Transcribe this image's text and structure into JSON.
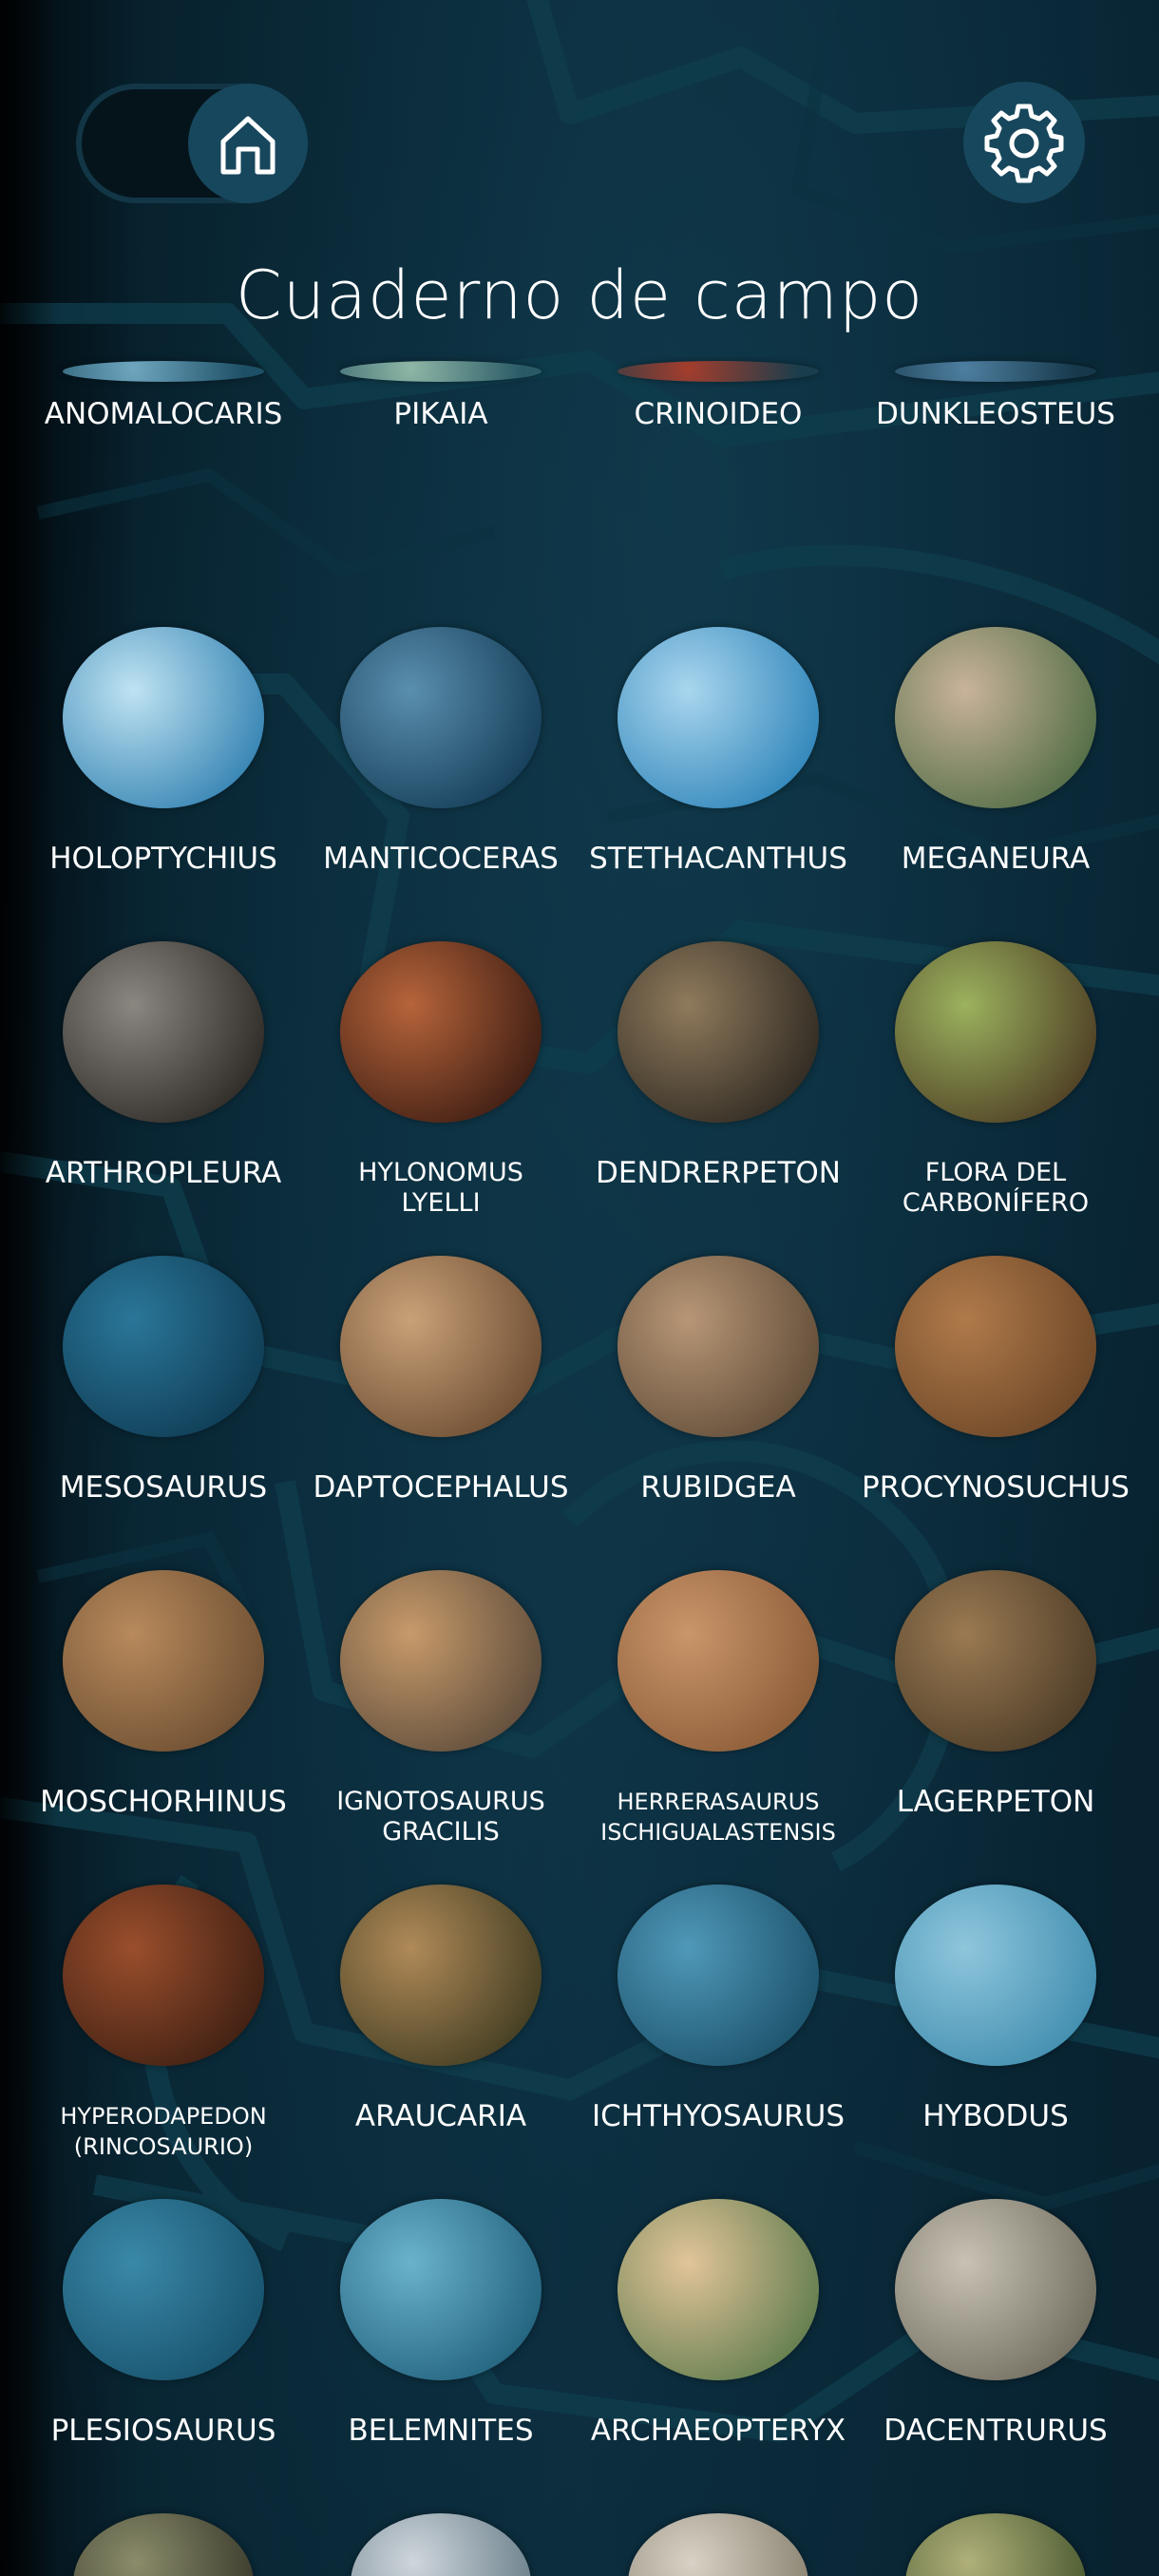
{
  "header": {
    "title": "Cuaderno de campo",
    "home_icon": "home-icon",
    "settings_icon": "gear-icon"
  },
  "colors": {
    "background": "#0a2837",
    "button": "#17475c",
    "text": "#ffffff"
  },
  "entries": [
    {
      "label": "ANOMALOCARIS",
      "palette": [
        "#6fa7bf",
        "#1d4f66"
      ]
    },
    {
      "label": "PIKAIA",
      "palette": [
        "#8fb7a6",
        "#2a5a66"
      ]
    },
    {
      "label": "CRINOIDEO",
      "palette": [
        "#a43d2c",
        "#1a3d4c"
      ]
    },
    {
      "label": "DUNKLEOSTEUS",
      "palette": [
        "#4e7fa0",
        "#16384a"
      ]
    },
    {
      "label": "HOLOPTYCHIUS",
      "palette": [
        "#bfe3f2",
        "#2f7fb0"
      ]
    },
    {
      "label": "MANTICOCERAS",
      "palette": [
        "#5a8fae",
        "#123a55"
      ]
    },
    {
      "label": "STETHACANTHUS",
      "palette": [
        "#a9d6ee",
        "#2b82b8"
      ]
    },
    {
      "label": "MEGANEURA",
      "palette": [
        "#c9b39a",
        "#4d6a42"
      ]
    },
    {
      "label": "ARTHROPLEURA",
      "palette": [
        "#8a8680",
        "#2a2622"
      ]
    },
    {
      "label": "HYLONOMUS LYELLI",
      "palette": [
        "#b6643a",
        "#3a1b12"
      ]
    },
    {
      "label": "DENDRERPETON",
      "palette": [
        "#8f7a5c",
        "#2c2720"
      ]
    },
    {
      "label": "FLORA DEL CARBONÍFERO",
      "palette": [
        "#9bb25e",
        "#4b3a22"
      ]
    },
    {
      "label": "MESOSAURUS",
      "palette": [
        "#2a7699",
        "#0e3a52"
      ]
    },
    {
      "label": "DAPTOCEPHALUS",
      "palette": [
        "#c9a178",
        "#6a4a30"
      ]
    },
    {
      "label": "RUBIDGEA",
      "palette": [
        "#b79676",
        "#5e4a36"
      ]
    },
    {
      "label": "PROCYNOSUCHUS",
      "palette": [
        "#b07a4a",
        "#6a4526"
      ]
    },
    {
      "label": "MOSCHORHINUS",
      "palette": [
        "#b88a5c",
        "#6a4c30"
      ]
    },
    {
      "label": "IGNOTOSAURUS GRACILIS",
      "palette": [
        "#c79a6a",
        "#5b4a3a"
      ]
    },
    {
      "label": "HERRERASAURUS ISCHIGUALASTENSIS",
      "palette": [
        "#c9956a",
        "#8a5a36"
      ]
    },
    {
      "label": "LAGERPETON",
      "palette": [
        "#9a7a52",
        "#4a3a26"
      ]
    },
    {
      "label": "HYPERODAPEDON (RINCOSAURIO)",
      "palette": [
        "#9a4e2c",
        "#3c1e12"
      ]
    },
    {
      "label": "ARAUCARIA",
      "palette": [
        "#b08a58",
        "#3e3a20"
      ]
    },
    {
      "label": "ICHTHYOSAURUS",
      "palette": [
        "#4f98b8",
        "#1a4f68"
      ]
    },
    {
      "label": "HYBODUS",
      "palette": [
        "#8ec6dc",
        "#3e8bad"
      ]
    },
    {
      "label": "PLESIOSAURUS",
      "palette": [
        "#3a88a8",
        "#16506a"
      ]
    },
    {
      "label": "BELEMNITES",
      "palette": [
        "#6ab2cc",
        "#1f5f7a"
      ]
    },
    {
      "label": "ARCHAEOPTERYX",
      "palette": [
        "#e2c49a",
        "#5c7a4a"
      ]
    },
    {
      "label": "DACENTRURUS",
      "palette": [
        "#c8c2b4",
        "#6d6a5c"
      ]
    },
    {
      "label": "",
      "palette": [
        "#8a8c6a",
        "#3a3a2c"
      ]
    },
    {
      "label": "",
      "palette": [
        "#cfd6dc",
        "#6a7f8a"
      ]
    },
    {
      "label": "",
      "palette": [
        "#d8d2c6",
        "#8a8270"
      ]
    },
    {
      "label": "",
      "palette": [
        "#b0b07a",
        "#4a5a30"
      ]
    }
  ]
}
